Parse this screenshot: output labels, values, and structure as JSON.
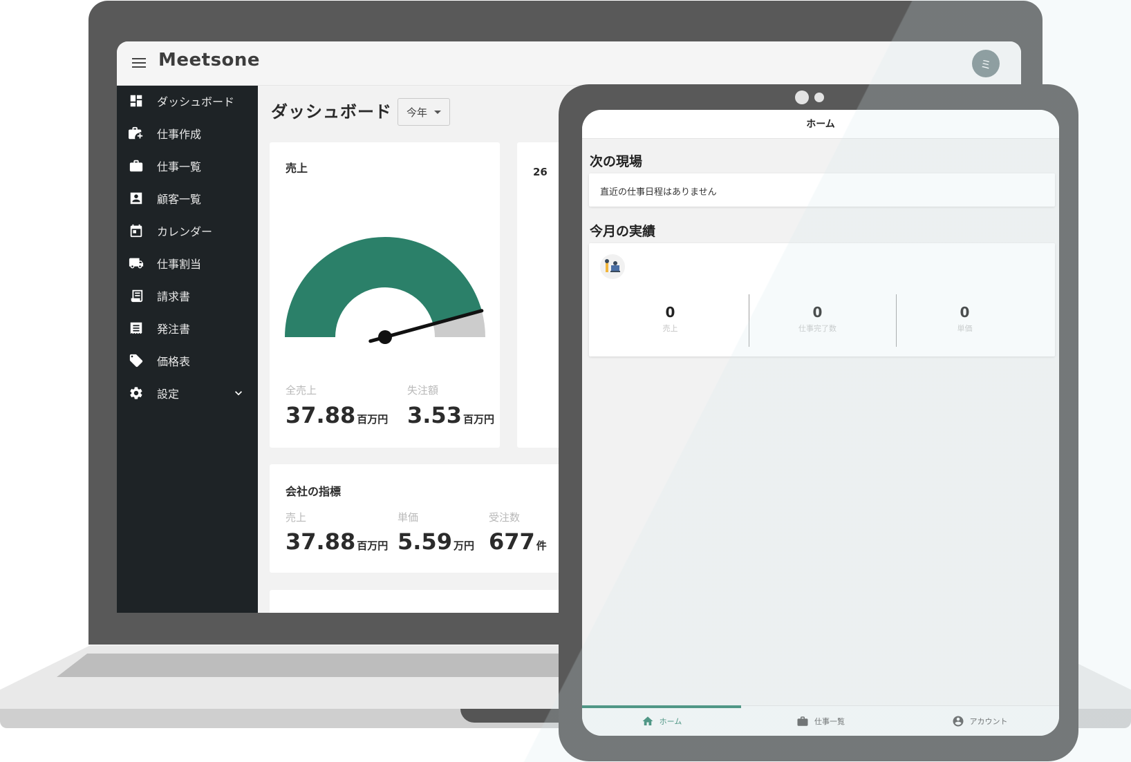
{
  "colors": {
    "gauge_fill": "#2b8069",
    "gauge_rest": "#cccccc",
    "sidebar_bg": "#1e2326",
    "accent": "#2b8069"
  },
  "laptop": {
    "logo": "Meetsone",
    "avatar_initial": "ミ",
    "sidebar": {
      "items": [
        {
          "label": "ダッシュボード",
          "icon": "dashboard-icon"
        },
        {
          "label": "仕事作成",
          "icon": "work-add-icon"
        },
        {
          "label": "仕事一覧",
          "icon": "briefcase-icon"
        },
        {
          "label": "顧客一覧",
          "icon": "contact-card-icon"
        },
        {
          "label": "カレンダー",
          "icon": "calendar-icon"
        },
        {
          "label": "仕事割当",
          "icon": "truck-icon"
        },
        {
          "label": "請求書",
          "icon": "receipt-icon"
        },
        {
          "label": "発注書",
          "icon": "order-list-icon"
        },
        {
          "label": "価格表",
          "icon": "tag-icon"
        },
        {
          "label": "設定",
          "icon": "gear-icon"
        }
      ]
    },
    "page_title": "ダッシュボード",
    "period": "今年",
    "sales_card": {
      "title": "売上",
      "gauge_fraction": 0.915,
      "total_label": "全売上",
      "total_value": "37.88",
      "total_unit": "百万円",
      "lost_label": "失注額",
      "lost_value": "3.53",
      "lost_unit": "百万円"
    },
    "second_card": {
      "title_partial": "26"
    },
    "company_card": {
      "title": "会社の指標",
      "sales_label": "売上",
      "sales_value": "37.88",
      "sales_unit": "百万円",
      "unit_price_label": "単価",
      "unit_price_value": "5.59",
      "unit_price_unit": "万円",
      "orders_label": "受注数",
      "orders_value": "677",
      "orders_unit": "件"
    }
  },
  "tablet": {
    "header_title": "ホーム",
    "next_site_title": "次の現場",
    "next_site_empty": "直近の仕事日程はありません",
    "monthly_title": "今月の実績",
    "metrics": [
      {
        "value": "0",
        "label": "売上"
      },
      {
        "value": "0",
        "label": "仕事完了数"
      },
      {
        "value": "0",
        "label": "単価"
      }
    ],
    "tabs": [
      {
        "label": "ホーム",
        "icon": "home-icon"
      },
      {
        "label": "仕事一覧",
        "icon": "briefcase-icon"
      },
      {
        "label": "アカウント",
        "icon": "account-circle-icon"
      }
    ]
  }
}
